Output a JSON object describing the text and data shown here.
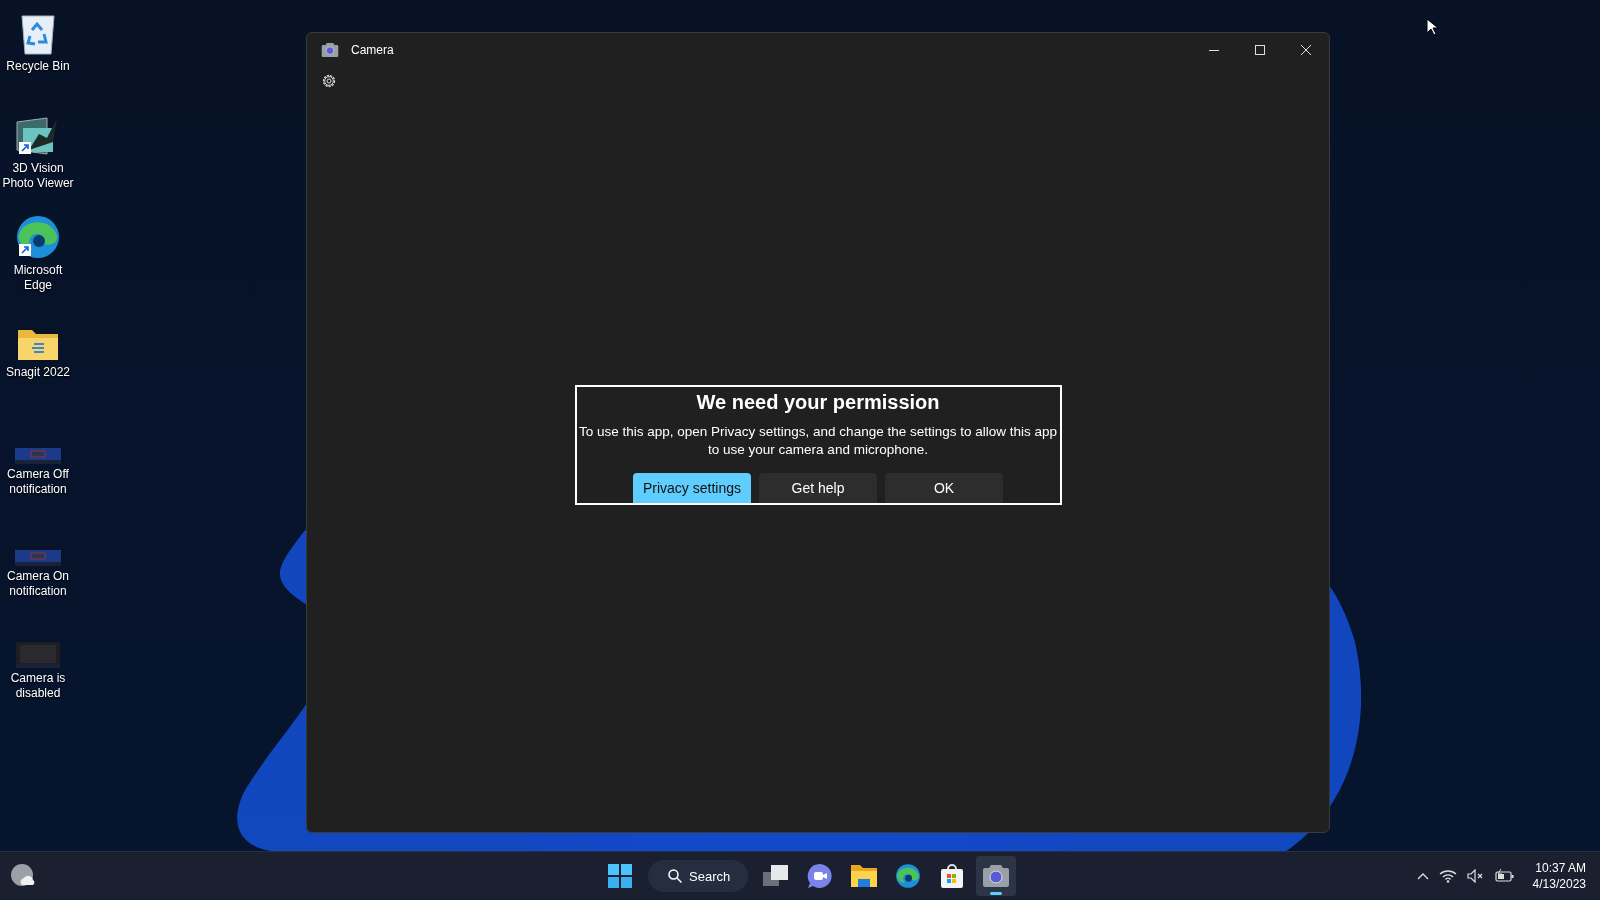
{
  "desktop_icons": [
    {
      "label": "Recycle Bin",
      "kind": "recycle-bin",
      "shortcut": false
    },
    {
      "label": "3D Vision Photo Viewer",
      "kind": "photo-viewer",
      "shortcut": true
    },
    {
      "label": "Microsoft Edge",
      "kind": "edge",
      "shortcut": true
    },
    {
      "label": "Snagit 2022",
      "kind": "folder",
      "shortcut": false
    },
    {
      "label": "Camera Off notification",
      "kind": "thumbnail",
      "shortcut": false
    },
    {
      "label": "Camera On notification",
      "kind": "thumbnail",
      "shortcut": false
    },
    {
      "label": "Camera is disabled",
      "kind": "thumbnail-dark",
      "shortcut": false
    }
  ],
  "window": {
    "title": "Camera"
  },
  "dialog": {
    "title": "We need your permission",
    "message": "To use this app, open Privacy settings, and change the settings to allow this app to use your camera and microphone.",
    "buttons": [
      {
        "label": "Privacy settings",
        "primary": true
      },
      {
        "label": "Get help",
        "primary": false
      },
      {
        "label": "OK",
        "primary": false
      }
    ]
  },
  "taskbar": {
    "items": [
      {
        "kind": "start",
        "active": false
      },
      {
        "kind": "search",
        "label": "Search",
        "active": false
      },
      {
        "kind": "task-view",
        "active": false
      },
      {
        "kind": "chat",
        "active": false
      },
      {
        "kind": "explorer",
        "active": false
      },
      {
        "kind": "edge",
        "active": false
      },
      {
        "kind": "store",
        "active": false
      },
      {
        "kind": "camera",
        "active": true
      }
    ],
    "clock": {
      "time": "10:37 AM",
      "date": "4/13/2023"
    }
  }
}
